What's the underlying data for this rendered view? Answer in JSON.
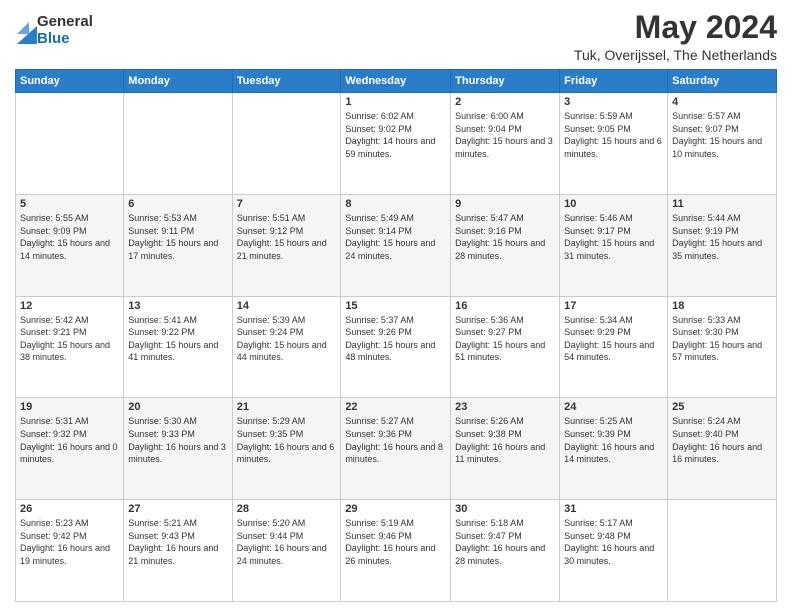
{
  "logo": {
    "general": "General",
    "blue": "Blue"
  },
  "title": "May 2024",
  "subtitle": "Tuk, Overijssel, The Netherlands",
  "days_of_week": [
    "Sunday",
    "Monday",
    "Tuesday",
    "Wednesday",
    "Thursday",
    "Friday",
    "Saturday"
  ],
  "weeks": [
    [
      {
        "day": "",
        "info": ""
      },
      {
        "day": "",
        "info": ""
      },
      {
        "day": "",
        "info": ""
      },
      {
        "day": "1",
        "info": "Sunrise: 6:02 AM\nSunset: 9:02 PM\nDaylight: 14 hours and 59 minutes."
      },
      {
        "day": "2",
        "info": "Sunrise: 6:00 AM\nSunset: 9:04 PM\nDaylight: 15 hours and 3 minutes."
      },
      {
        "day": "3",
        "info": "Sunrise: 5:59 AM\nSunset: 9:05 PM\nDaylight: 15 hours and 6 minutes."
      },
      {
        "day": "4",
        "info": "Sunrise: 5:57 AM\nSunset: 9:07 PM\nDaylight: 15 hours and 10 minutes."
      }
    ],
    [
      {
        "day": "5",
        "info": "Sunrise: 5:55 AM\nSunset: 9:09 PM\nDaylight: 15 hours and 14 minutes."
      },
      {
        "day": "6",
        "info": "Sunrise: 5:53 AM\nSunset: 9:11 PM\nDaylight: 15 hours and 17 minutes."
      },
      {
        "day": "7",
        "info": "Sunrise: 5:51 AM\nSunset: 9:12 PM\nDaylight: 15 hours and 21 minutes."
      },
      {
        "day": "8",
        "info": "Sunrise: 5:49 AM\nSunset: 9:14 PM\nDaylight: 15 hours and 24 minutes."
      },
      {
        "day": "9",
        "info": "Sunrise: 5:47 AM\nSunset: 9:16 PM\nDaylight: 15 hours and 28 minutes."
      },
      {
        "day": "10",
        "info": "Sunrise: 5:46 AM\nSunset: 9:17 PM\nDaylight: 15 hours and 31 minutes."
      },
      {
        "day": "11",
        "info": "Sunrise: 5:44 AM\nSunset: 9:19 PM\nDaylight: 15 hours and 35 minutes."
      }
    ],
    [
      {
        "day": "12",
        "info": "Sunrise: 5:42 AM\nSunset: 9:21 PM\nDaylight: 15 hours and 38 minutes."
      },
      {
        "day": "13",
        "info": "Sunrise: 5:41 AM\nSunset: 9:22 PM\nDaylight: 15 hours and 41 minutes."
      },
      {
        "day": "14",
        "info": "Sunrise: 5:39 AM\nSunset: 9:24 PM\nDaylight: 15 hours and 44 minutes."
      },
      {
        "day": "15",
        "info": "Sunrise: 5:37 AM\nSunset: 9:26 PM\nDaylight: 15 hours and 48 minutes."
      },
      {
        "day": "16",
        "info": "Sunrise: 5:36 AM\nSunset: 9:27 PM\nDaylight: 15 hours and 51 minutes."
      },
      {
        "day": "17",
        "info": "Sunrise: 5:34 AM\nSunset: 9:29 PM\nDaylight: 15 hours and 54 minutes."
      },
      {
        "day": "18",
        "info": "Sunrise: 5:33 AM\nSunset: 9:30 PM\nDaylight: 15 hours and 57 minutes."
      }
    ],
    [
      {
        "day": "19",
        "info": "Sunrise: 5:31 AM\nSunset: 9:32 PM\nDaylight: 16 hours and 0 minutes."
      },
      {
        "day": "20",
        "info": "Sunrise: 5:30 AM\nSunset: 9:33 PM\nDaylight: 16 hours and 3 minutes."
      },
      {
        "day": "21",
        "info": "Sunrise: 5:29 AM\nSunset: 9:35 PM\nDaylight: 16 hours and 6 minutes."
      },
      {
        "day": "22",
        "info": "Sunrise: 5:27 AM\nSunset: 9:36 PM\nDaylight: 16 hours and 8 minutes."
      },
      {
        "day": "23",
        "info": "Sunrise: 5:26 AM\nSunset: 9:38 PM\nDaylight: 16 hours and 11 minutes."
      },
      {
        "day": "24",
        "info": "Sunrise: 5:25 AM\nSunset: 9:39 PM\nDaylight: 16 hours and 14 minutes."
      },
      {
        "day": "25",
        "info": "Sunrise: 5:24 AM\nSunset: 9:40 PM\nDaylight: 16 hours and 16 minutes."
      }
    ],
    [
      {
        "day": "26",
        "info": "Sunrise: 5:23 AM\nSunset: 9:42 PM\nDaylight: 16 hours and 19 minutes."
      },
      {
        "day": "27",
        "info": "Sunrise: 5:21 AM\nSunset: 9:43 PM\nDaylight: 16 hours and 21 minutes."
      },
      {
        "day": "28",
        "info": "Sunrise: 5:20 AM\nSunset: 9:44 PM\nDaylight: 16 hours and 24 minutes."
      },
      {
        "day": "29",
        "info": "Sunrise: 5:19 AM\nSunset: 9:46 PM\nDaylight: 16 hours and 26 minutes."
      },
      {
        "day": "30",
        "info": "Sunrise: 5:18 AM\nSunset: 9:47 PM\nDaylight: 16 hours and 28 minutes."
      },
      {
        "day": "31",
        "info": "Sunrise: 5:17 AM\nSunset: 9:48 PM\nDaylight: 16 hours and 30 minutes."
      },
      {
        "day": "",
        "info": ""
      }
    ]
  ]
}
